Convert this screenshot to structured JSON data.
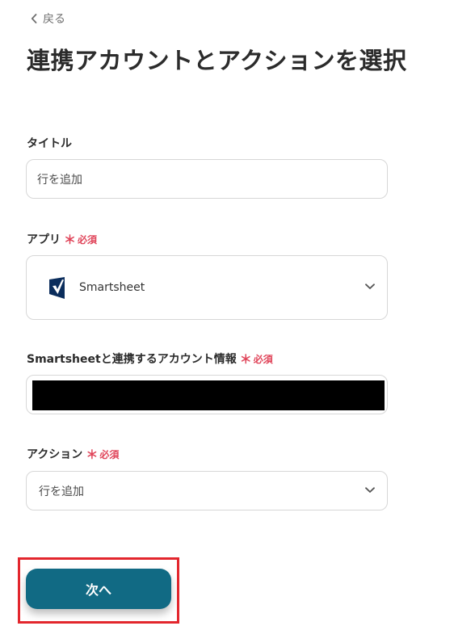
{
  "nav": {
    "back_label": "戻る"
  },
  "page": {
    "title": "連携アカウントとアクションを選択"
  },
  "fields": {
    "title": {
      "label": "タイトル",
      "value": "行を追加"
    },
    "app": {
      "label": "アプリ",
      "required_mark": "＊",
      "required_text": "必須",
      "value": "Smartsheet",
      "icon": "smartsheet-logo"
    },
    "account": {
      "label": "Smartsheetと連携するアカウント情報",
      "required_mark": "＊",
      "required_text": "必須",
      "value_redacted": true
    },
    "action": {
      "label": "アクション",
      "required_mark": "＊",
      "required_text": "必須",
      "value": "行を追加"
    }
  },
  "footer": {
    "next_label": "次へ"
  },
  "colors": {
    "primary_button": "#116a84",
    "required": "#e0455a",
    "highlight": "#e3262d",
    "smartsheet_logo": "#0b2d5c"
  }
}
